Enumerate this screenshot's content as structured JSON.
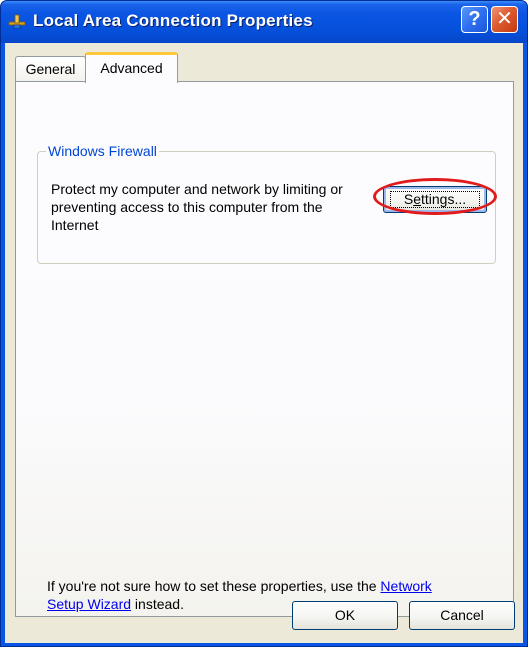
{
  "window": {
    "title": "Local Area Connection Properties",
    "help_glyph": "?",
    "close_glyph": "✕"
  },
  "tabs": [
    {
      "label": "General",
      "active": false
    },
    {
      "label": "Advanced",
      "active": true
    }
  ],
  "firewall": {
    "group_title": "Windows Firewall",
    "description": "Protect my computer and network by limiting or preventing access to this computer from the Internet",
    "settings_label_pre": "S",
    "settings_label_mnemonic": "e",
    "settings_label_post": "ttings...",
    "highlight_color": "#e11b1b"
  },
  "help": {
    "text_before": "If you're not sure how to set these properties, use the ",
    "link_text": "Network Setup Wizard",
    "text_after": " instead."
  },
  "buttons": {
    "ok": "OK",
    "cancel": "Cancel"
  },
  "colors": {
    "titlebar": "#0a55e3",
    "dialog_bg": "#ece9d8",
    "tab_accent": "#ffc83c",
    "link": "#0000ee",
    "group_title": "#0046d5"
  },
  "icons": {
    "title": "network-connection-icon",
    "help": "help-icon",
    "close": "close-icon"
  }
}
